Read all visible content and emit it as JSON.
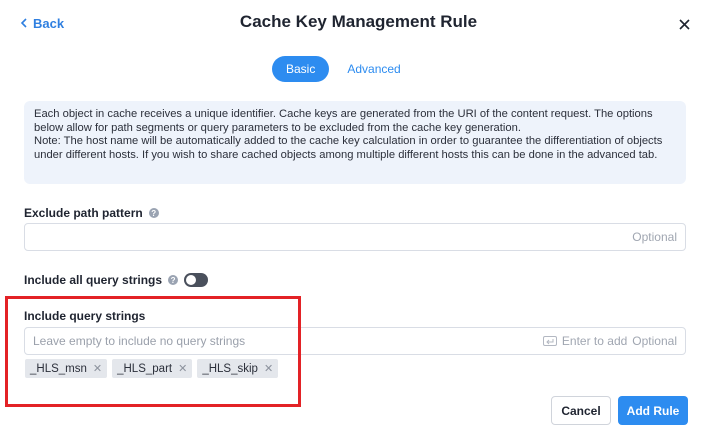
{
  "header": {
    "back_label": "Back",
    "title": "Cache Key Management Rule"
  },
  "tabs": [
    {
      "label": "Basic",
      "active": true
    },
    {
      "label": "Advanced",
      "active": false
    }
  ],
  "info": {
    "line1": "Each object in cache receives a unique identifier. Cache keys are generated from the URI of the content request. The options below allow for path segments or query parameters to be excluded from the cache key generation.",
    "line2": "Note: The host name will be automatically added to the cache key calculation in order to guarantee the differentiation of objects under different hosts. If you wish to share cached objects among multiple different hosts this can be done in the advanced tab."
  },
  "exclude_path": {
    "label": "Exclude path pattern",
    "value": "",
    "optional": "Optional"
  },
  "include_all": {
    "label": "Include all query strings",
    "enabled": false
  },
  "include_query": {
    "label": "Include query strings",
    "placeholder": "Leave empty to include no query strings",
    "enter_hint": "Enter to add",
    "optional": "Optional",
    "tags": [
      "_HLS_msn",
      "_HLS_part",
      "_HLS_skip"
    ]
  },
  "footer": {
    "cancel_label": "Cancel",
    "add_label": "Add Rule"
  },
  "colors": {
    "accent": "#2d8cf0",
    "highlight_box": "#e32226"
  }
}
